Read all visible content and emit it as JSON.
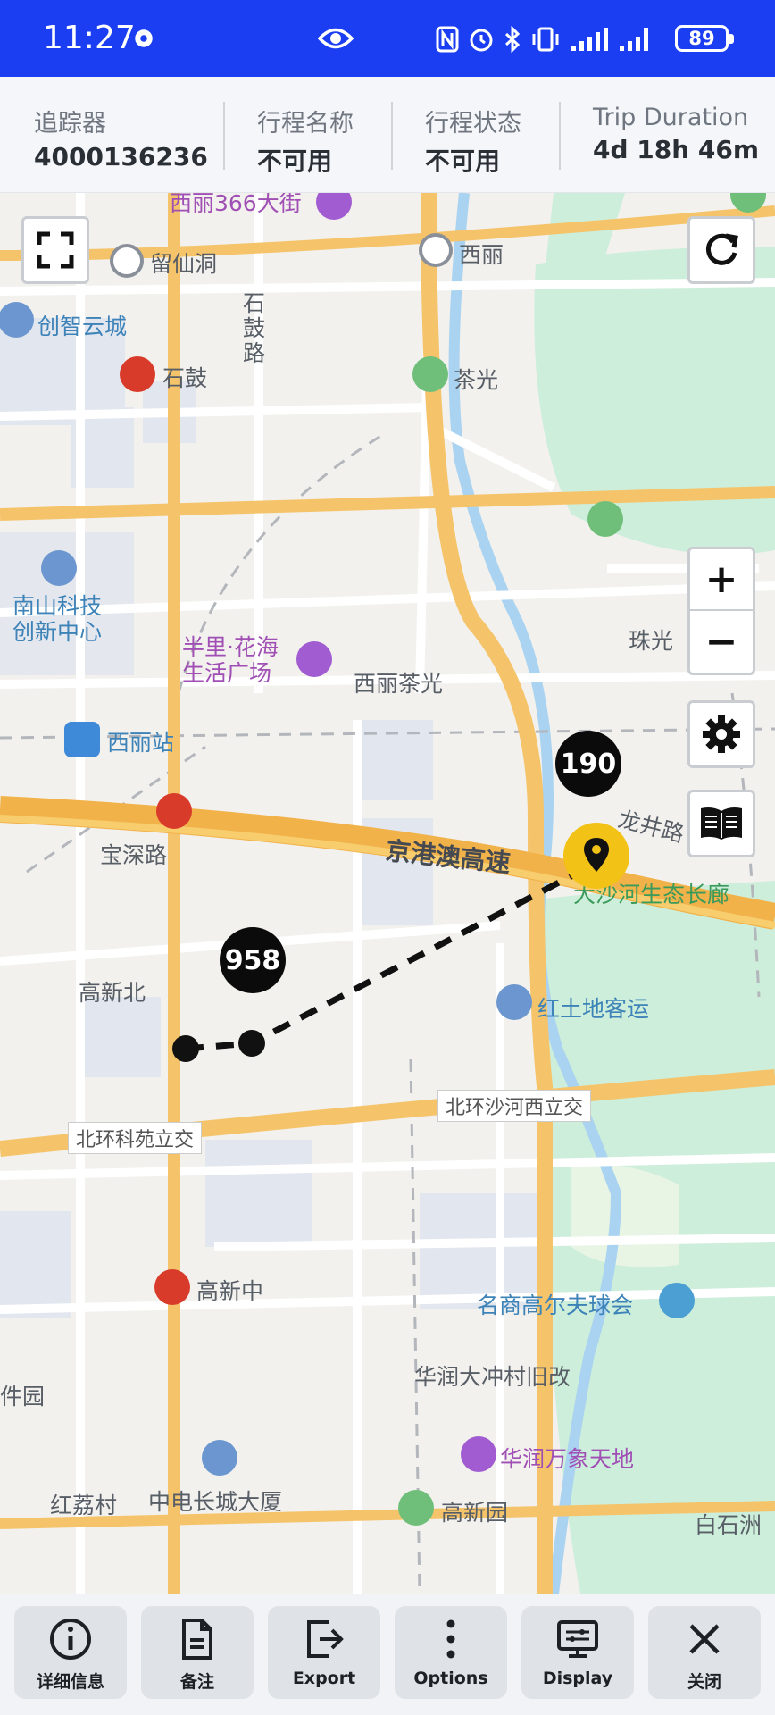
{
  "status_bar": {
    "time": "11:27",
    "battery": "89"
  },
  "info_header": [
    {
      "label": "追踪器",
      "value": "4000136236"
    },
    {
      "label": "行程名称",
      "value": "不可用"
    },
    {
      "label": "行程状态",
      "value": "不可用"
    },
    {
      "label": "Trip Duration",
      "value": "4d 18h 46m"
    }
  ],
  "map": {
    "labels": {
      "xili366": "西丽366大街",
      "liuxiandong": "留仙洞",
      "xili": "西丽",
      "shigu_road": "石鼓路",
      "chuangzhi": "创智云城",
      "shigu": "石鼓",
      "chaguang": "茶光",
      "nanshan_tech": "南山科技创新中心",
      "banli": "半里·花海生活广场",
      "xili_chaguang": "西丽茶光",
      "zhuguang": "珠光",
      "xili_station": "西丽站",
      "longjing": "龙井路",
      "baoshen": "宝深路",
      "jinggangao": "京港澳高速",
      "dasha_river": "大沙河生态长廊",
      "gaoxinbei": "高新北",
      "hongtudi": "红土地客运",
      "beihuan_shahe": "北环沙河西立交",
      "beihuan_keyuan": "北环科苑立交",
      "gaoxinzhong": "高新中",
      "mingshang": "名商高尔夫球会",
      "huarun_dachong": "华润大冲村旧改",
      "huarun_wanxiang": "华润万象天地",
      "jian_yuan": "件园",
      "honglicun": "红荔村",
      "zhongdian": "中电长城大厦",
      "gaoxinyuan": "高新园",
      "baishizhou": "白石洲"
    },
    "markers": {
      "badge_a": "190",
      "badge_b": "958"
    },
    "controls": {
      "zoom_in": "+",
      "zoom_out": "−"
    }
  },
  "toolbar": [
    {
      "label": "详细信息",
      "icon": "info-icon"
    },
    {
      "label": "备注",
      "icon": "notes-icon"
    },
    {
      "label": "Export",
      "icon": "export-icon"
    },
    {
      "label": "Options",
      "icon": "more-vertical-icon"
    },
    {
      "label": "Display",
      "icon": "display-icon"
    },
    {
      "label": "关闭",
      "icon": "close-icon"
    }
  ],
  "colors": {
    "status_bar": "#1b3ef2",
    "highway": "#f5c46a",
    "marker": "#f2c216",
    "water": "#a9d3f0",
    "park": "#cdeedb"
  }
}
